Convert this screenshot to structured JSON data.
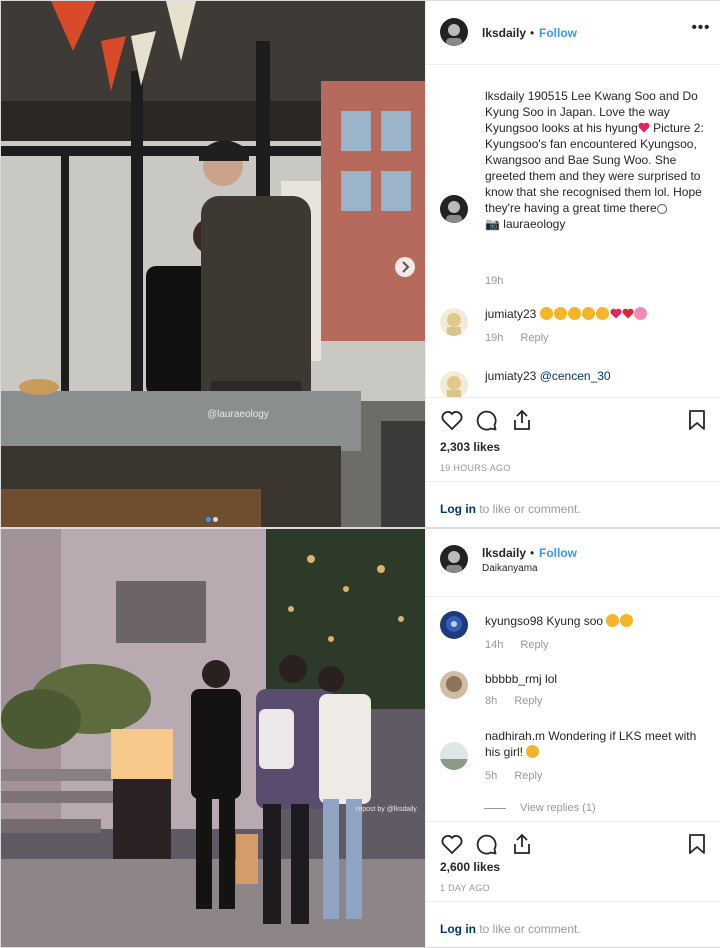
{
  "post1": {
    "header": {
      "username": "lksdaily",
      "separator": "•",
      "follow_label": "Follow",
      "more_label": "•••"
    },
    "caption": {
      "username": "lksdaily",
      "text": "190515 Lee Kwang Soo and Do Kyung Soo in Japan. Love the way Kyungsoo looks at his hyung",
      "text2": "Picture 2: Kyungsoo's fan encountered Kyungsoo, Kwangsoo and Bae Sung Woo. She greeted them and they were surprised to know that she recognised them lol. Hope they're having a great time there",
      "credit": "laurae­ology",
      "time": "19h"
    },
    "comments": [
      {
        "username": "jumiaty23",
        "text": "",
        "time": "19h",
        "reply_label": "Reply"
      },
      {
        "username": "jumiaty23",
        "mention": "@cencen_30",
        "text": ""
      }
    ],
    "likes": "2,303 likes",
    "ago": "19 HOURS AGO",
    "login": {
      "link": "Log in",
      "rest": " to like or comment."
    },
    "photo_watermark": "@lauraeology"
  },
  "post2": {
    "header": {
      "username": "lksdaily",
      "separator": "•",
      "follow_label": "Follow",
      "location": "Daikanyama"
    },
    "comments": [
      {
        "username": "kyungso98",
        "text": "Kyung soo",
        "time": "14h",
        "reply_label": "Reply"
      },
      {
        "username": "bbbbb_rmj",
        "text": "lol",
        "time": "8h",
        "reply_label": "Reply"
      },
      {
        "username": "nadhirah.m",
        "text": "Wondering if LKS meet with his girl!",
        "time": "5h",
        "reply_label": "Reply"
      }
    ],
    "view_replies": "View replies (1)",
    "likes": "2,600 likes",
    "ago": "1 DAY AGO",
    "login": {
      "link": "Log in",
      "rest": " to like or comment."
    },
    "photo_watermark": "repost by @lksdaily"
  },
  "colors": {
    "accent": "#3897f0",
    "link": "#003569",
    "muted": "#999999",
    "border": "#dbdbdb"
  },
  "icons": [
    "heart-icon",
    "comment-icon",
    "share-icon",
    "bookmark-icon",
    "more-icon",
    "chevron-right-icon"
  ]
}
